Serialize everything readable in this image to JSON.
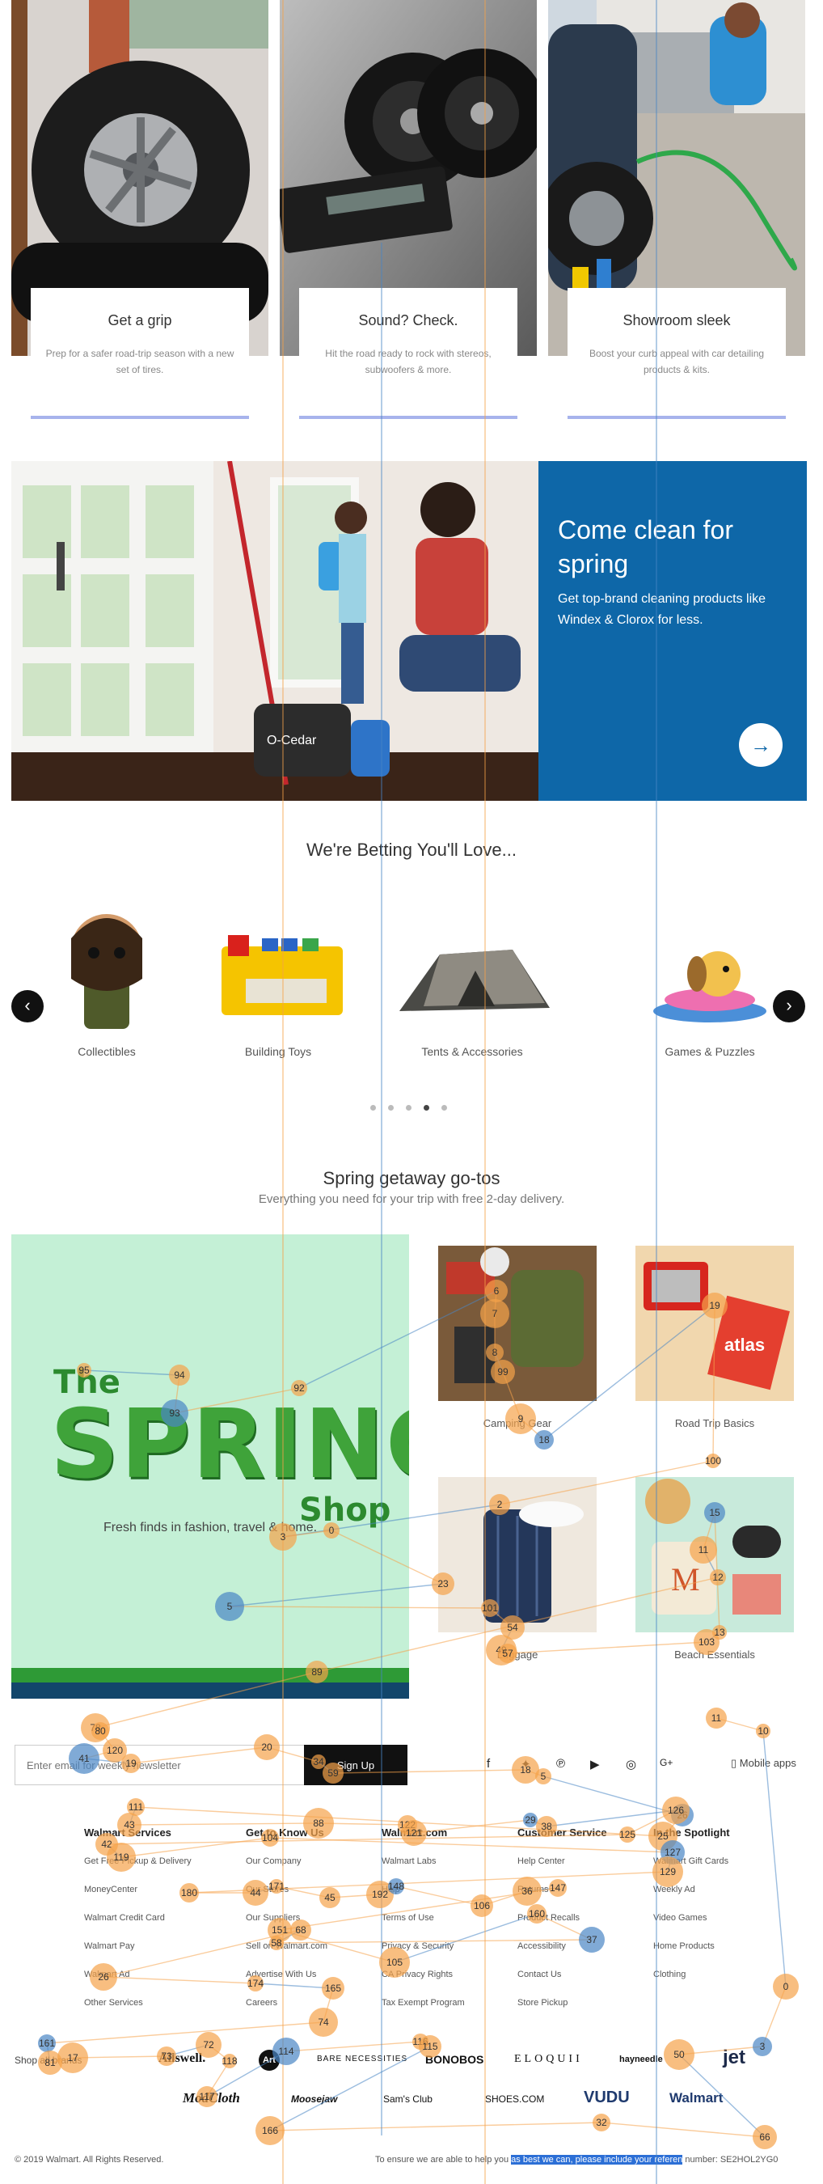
{
  "promos": [
    {
      "title": "Get a grip",
      "desc": "Prep for a safer road-trip season with a new set of tires."
    },
    {
      "title": "Sound? Check.",
      "desc": "Hit the road ready to rock with stereos, subwoofers & more."
    },
    {
      "title": "Showroom sleek",
      "desc": "Boost your curb appeal with car detailing products & kits."
    }
  ],
  "hero": {
    "title": "Come clean for spring",
    "subtitle": "Get top-brand cleaning products like Windex & Clorox for less.",
    "arrow": "→",
    "bucket_brand": "O-Cedar"
  },
  "carousel": {
    "title": "We're Betting You'll Love...",
    "items": [
      {
        "label": "Collectibles"
      },
      {
        "label": "Building Toys"
      },
      {
        "label": "Tents & Accessories"
      },
      {
        "label": "Games & Puzzles"
      }
    ],
    "prev": "‹",
    "next": "›",
    "dots": 5,
    "active_dot": 3
  },
  "spring": {
    "title": "Spring getaway go-tos",
    "subtitle": "Everything you need for your trip with free 2-day delivery.",
    "hero_the": "The",
    "hero_main": "SPRING",
    "hero_shop": "Shop",
    "hero_tagline": "Fresh finds in fashion, travel & home.",
    "tiles": [
      {
        "label": "Camping Gear"
      },
      {
        "label": "Road Trip Basics"
      },
      {
        "label": "Luggage"
      },
      {
        "label": "Beach Essentials"
      }
    ]
  },
  "footer": {
    "newsletter_placeholder": "Enter email for weekly newsletter",
    "signup": "Sign Up",
    "mobile_apps": "Mobile apps",
    "columns": [
      {
        "head": "Walmart Services",
        "links": [
          "Get Free Pickup & Delivery",
          "MoneyCenter",
          "Walmart Credit Card",
          "Walmart Pay",
          "Walmart Ad",
          "Other Services"
        ]
      },
      {
        "head": "Get to Know Us",
        "links": [
          "Our Company",
          "Our Stores",
          "Our Suppliers",
          "Sell on Walmart.com",
          "Advertise With Us",
          "Careers"
        ]
      },
      {
        "head": "Walmart.com",
        "links": [
          "Walmart Labs",
          "Help",
          "Terms of Use",
          "Privacy & Security",
          "CA Privacy Rights",
          "Tax Exempt Program"
        ]
      },
      {
        "head": "Customer Service",
        "links": [
          "Help Center",
          "Returns",
          "Product Recalls",
          "Accessibility",
          "Contact Us",
          "Store Pickup"
        ]
      },
      {
        "head": "In the Spotlight",
        "links": [
          "Walmart Gift Cards",
          "Weekly Ad",
          "Video Games",
          "Home Products",
          "Clothing"
        ]
      }
    ],
    "brands_row1": [
      "Shop all brands",
      "Allswell.",
      "Art",
      "BARE NECESSITIES",
      "BONOBOS",
      "ELOQUII",
      "hayneedle",
      "jet"
    ],
    "brands_row2": [
      "ModCloth",
      "Moosejaw",
      "Sam's Club",
      "SHOES.COM",
      "VUDU",
      "Walmart"
    ],
    "copyright": "© 2019 Walmart. All Rights Reserved.",
    "feedback_pre": "To ensure we are able to help you",
    "feedback_highlight": "as best we can, please include your referen",
    "feedback_post": "number: SE2HOL2YG0"
  },
  "overlay_numbers": [
    "95",
    "94",
    "93",
    "92",
    "6",
    "7",
    "8",
    "99",
    "9",
    "18",
    "19",
    "100",
    "2",
    "3",
    "0",
    "23",
    "5",
    "101",
    "54",
    "49",
    "57",
    "103",
    "13",
    "15",
    "11",
    "12",
    "89",
    "78",
    "80",
    "120",
    "41",
    "19",
    "20",
    "34",
    "59",
    "18",
    "5",
    "26",
    "25",
    "111",
    "43",
    "88",
    "122",
    "121",
    "29",
    "38",
    "126",
    "125",
    "42",
    "119",
    "104",
    "127",
    "129",
    "180",
    "44",
    "171",
    "45",
    "192",
    "148",
    "106",
    "36",
    "147",
    "151",
    "105",
    "160",
    "37",
    "58",
    "68",
    "26",
    "174",
    "165",
    "74",
    "161",
    "81",
    "17",
    "73",
    "72",
    "118",
    "117",
    "114",
    "116",
    "115",
    "166",
    "32",
    "66",
    "50",
    "3",
    "0",
    "10",
    "11",
    "15",
    "32",
    "35",
    "128"
  ],
  "colors": {
    "hero_blue": "#0e67a8",
    "promo_line": "#a7b3ec",
    "spring_bg": "#c4f0d6",
    "heat_orange": "#f5a24a",
    "heat_blue": "#4a86c5"
  }
}
